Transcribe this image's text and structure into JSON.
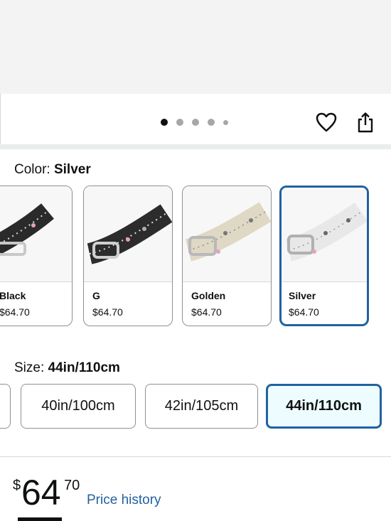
{
  "gallery": {
    "dots": [
      "active",
      "inactive",
      "inactive",
      "inactive",
      "small"
    ]
  },
  "actions": {
    "favorite_icon": "heart-icon",
    "share_icon": "share-icon"
  },
  "color_selector": {
    "label": "Color: ",
    "selected_value": "Silver",
    "options": [
      {
        "name": "Black",
        "price": "$64.70"
      },
      {
        "name": "G",
        "price": "$64.70"
      },
      {
        "name": "Golden",
        "price": "$64.70"
      },
      {
        "name": "Silver",
        "price": "$64.70"
      }
    ],
    "selected_color": "#2162a1"
  },
  "size_selector": {
    "label": "Size: ",
    "selected_value": "44in/110cm",
    "options": [
      "40in/100cm",
      "42in/105cm",
      "44in/110cm"
    ]
  },
  "price": {
    "symbol": "$",
    "whole": "64",
    "fraction": "70",
    "history_link": "Price history"
  },
  "colors": {
    "link": "#2162a1",
    "selected_bg": "#edfdff",
    "text": "#0f1111"
  }
}
